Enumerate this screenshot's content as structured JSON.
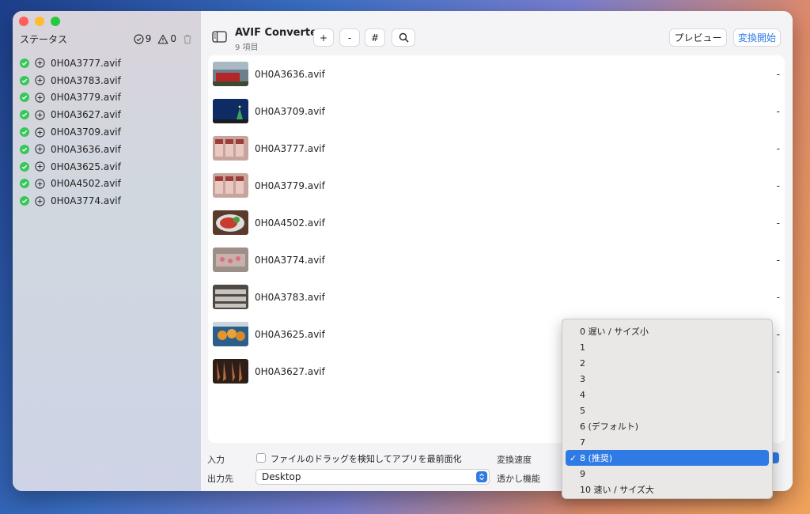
{
  "sidebar": {
    "title": "ステータス",
    "done_count": "9",
    "warn_count": "0",
    "items": [
      "0H0A3777.avif",
      "0H0A3783.avif",
      "0H0A3779.avif",
      "0H0A3627.avif",
      "0H0A3709.avif",
      "0H0A3636.avif",
      "0H0A3625.avif",
      "0H0A4502.avif",
      "0H0A3774.avif"
    ]
  },
  "toolbar": {
    "title": "AVIF Converter",
    "subtitle": "9 項目",
    "add_label": "+",
    "remove_label": "-",
    "number_label": "#",
    "preview_label": "プレビュー",
    "start_label": "変換開始"
  },
  "files": [
    {
      "name": "0H0A3636.avif",
      "size": "-",
      "thumb": "train"
    },
    {
      "name": "0H0A3709.avif",
      "size": "-",
      "thumb": "night-tree"
    },
    {
      "name": "0H0A3777.avif",
      "size": "-",
      "thumb": "fish"
    },
    {
      "name": "0H0A3779.avif",
      "size": "-",
      "thumb": "fish"
    },
    {
      "name": "0H0A4502.avif",
      "size": "-",
      "thumb": "food-plate"
    },
    {
      "name": "0H0A3774.avif",
      "size": "-",
      "thumb": "market"
    },
    {
      "name": "0H0A3783.avif",
      "size": "-",
      "thumb": "fish-rows"
    },
    {
      "name": "0H0A3625.avif",
      "size": "-",
      "thumb": "buns"
    },
    {
      "name": "0H0A3627.avif",
      "size": "-",
      "thumb": "hanging-food"
    }
  ],
  "settings": {
    "input_label": "入力",
    "drag_checkbox_label": "ファイルのドラッグを検知してアプリを最前面化",
    "output_label": "出力先",
    "output_value": "Desktop",
    "speed_label": "変換速度",
    "watermark_label": "透かし機能"
  },
  "speed_dropdown": {
    "selected_index": 8,
    "options": [
      "0 遅い / サイズ小",
      "1",
      "2",
      "3",
      "4",
      "5",
      "6 (デフォルト)",
      "7",
      "8 (推奨)",
      "9",
      "10 速い / サイズ大"
    ]
  },
  "colors": {
    "accent": "#2f7ae5",
    "success": "#35c759"
  }
}
